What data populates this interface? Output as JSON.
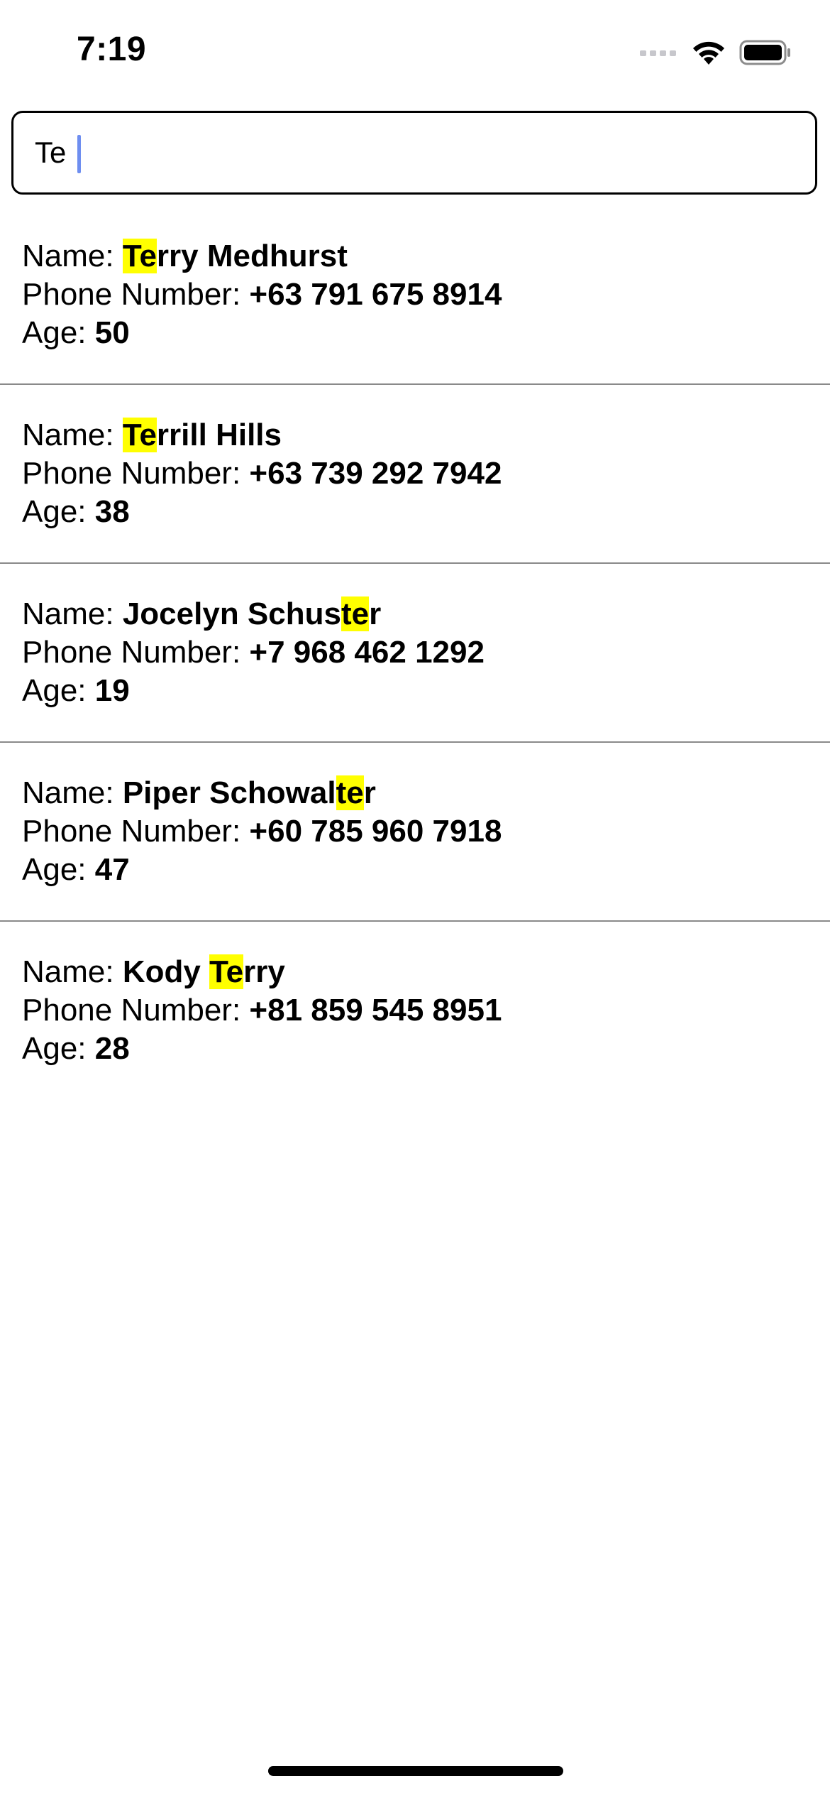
{
  "status_bar": {
    "time": "7:19",
    "icons": [
      "cellular-signal-icon",
      "wifi-icon",
      "battery-icon"
    ]
  },
  "search": {
    "value": "Te",
    "placeholder": ""
  },
  "highlight_color": "#ffff00",
  "labels": {
    "name": "Name: ",
    "phone": "Phone Number: ",
    "age": "Age: "
  },
  "contacts": [
    {
      "name_parts": [
        "",
        "Te",
        "rry Medhurst"
      ],
      "phone": "+63 791 675 8914",
      "age": "50"
    },
    {
      "name_parts": [
        "",
        "Te",
        "rrill Hills"
      ],
      "phone": "+63 739 292 7942",
      "age": "38"
    },
    {
      "name_parts": [
        "Jocelyn Schus",
        "te",
        "r"
      ],
      "phone": "+7 968 462 1292",
      "age": "19"
    },
    {
      "name_parts": [
        "Piper Schowal",
        "te",
        "r"
      ],
      "phone": "+60 785 960 7918",
      "age": "47"
    },
    {
      "name_parts": [
        "Kody ",
        "Te",
        "rry"
      ],
      "phone": "+81 859 545 8951",
      "age": "28"
    }
  ]
}
